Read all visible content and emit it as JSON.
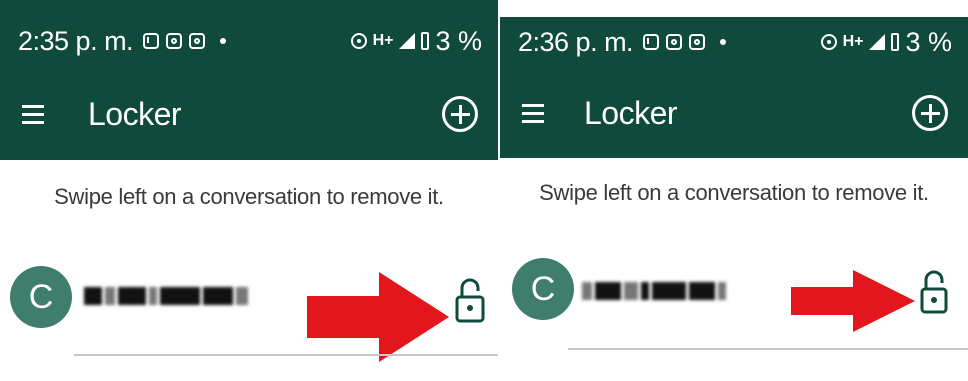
{
  "panels": [
    {
      "status": {
        "time": "2:35 p. m.",
        "network": "H+",
        "battery": "3 %"
      },
      "toolbar": {
        "title": "Locker"
      },
      "hint": "Swipe left on a conversation to remove it.",
      "conversation": {
        "avatar_letter": "C"
      },
      "arrow_color": "#e4161d"
    },
    {
      "status": {
        "time": "2:36 p. m.",
        "network": "H+",
        "battery": "3 %"
      },
      "toolbar": {
        "title": "Locker"
      },
      "hint": "Swipe left on a conversation to remove it.",
      "conversation": {
        "avatar_letter": "C"
      },
      "arrow_color": "#e4161d"
    }
  ],
  "colors": {
    "appbar": "#0f4a3c",
    "avatar": "#3f7d6d",
    "accent": "#0f4a3c"
  },
  "icons": [
    "menu-icon",
    "add-circle-icon",
    "lock-icon",
    "gmail-icon",
    "instagram-icon",
    "hotspot-icon",
    "signal-icon",
    "battery-icon"
  ]
}
